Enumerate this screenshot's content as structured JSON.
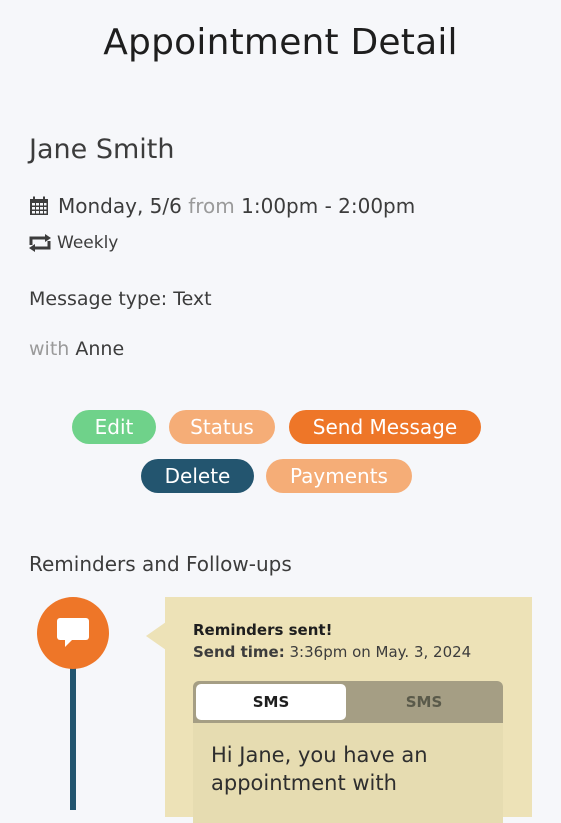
{
  "header": {
    "title": "Appointment Detail"
  },
  "appointment": {
    "client_name": "Jane Smith",
    "date": "Monday, 5/6",
    "from_word": "from",
    "time_range": "1:00pm - 2:00pm",
    "recurrence": "Weekly",
    "message_type": "Message type: Text",
    "with_word": "with",
    "with_person": "Anne"
  },
  "actions": {
    "edit": "Edit",
    "status": "Status",
    "send_message": "Send Message",
    "delete": "Delete",
    "payments": "Payments"
  },
  "reminders": {
    "section_title": "Reminders and Follow-ups",
    "items": [
      {
        "title": "Reminders sent!",
        "send_time_label": "Send time:",
        "send_time_value": "3:36pm on May. 3, 2024",
        "tabs": [
          "SMS",
          "SMS"
        ],
        "message": "Hi Jane, you have an appointment with"
      }
    ]
  },
  "colors": {
    "green": "#6fd28a",
    "light_orange": "#f5ad77",
    "orange": "#ee7628",
    "navy": "#23556f",
    "card": "#ede2b7"
  },
  "icons": {
    "calendar": "calendar-icon",
    "repeat": "repeat-icon",
    "chat": "chat-bubble-icon"
  }
}
